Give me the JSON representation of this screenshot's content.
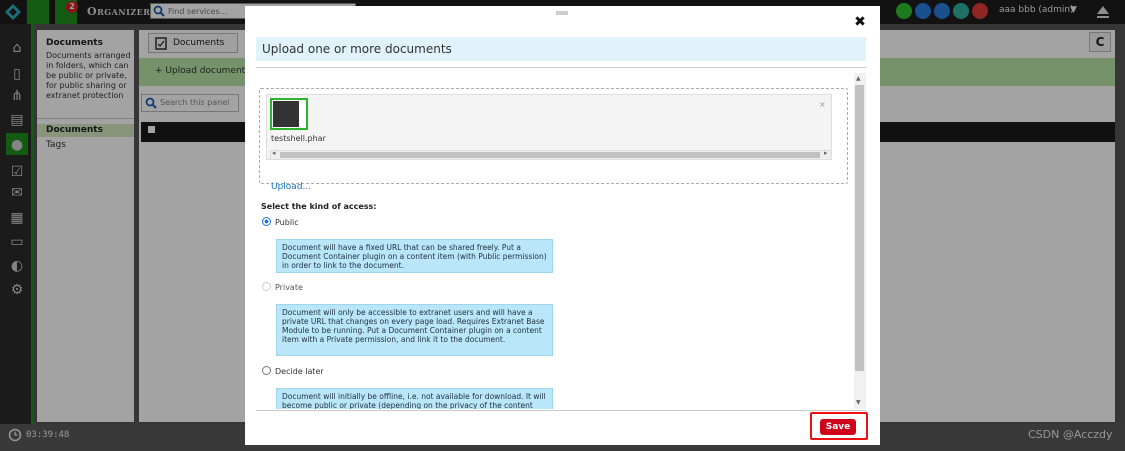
{
  "topbar": {
    "app_title": "Organizer",
    "search_placeholder": "Find services...",
    "notification_count": "2",
    "user_label": "aaa bbb (admin)",
    "user_caret": "▼",
    "status_icons": [
      "power-icon",
      "users-icon",
      "info-icon",
      "network-icon",
      "move-icon"
    ],
    "status_colors": [
      "#2ec02e",
      "#2b7de0",
      "#2b7de0",
      "#31b0a0",
      "#e03b3b"
    ]
  },
  "rail": {
    "icons": [
      "home-icon",
      "document-icon",
      "hierarchy-icon",
      "file-active-icon",
      "user-icon",
      "checkbox-icon",
      "mail-icon",
      "grid-icon",
      "folder-icon",
      "globe-icon",
      "settings-icon"
    ]
  },
  "sidebar": {
    "title": "Documents",
    "description": "Documents arranged in folders, which can be public or private, for public sharing or extranet protection",
    "items": [
      {
        "label": "Documents",
        "active": true
      },
      {
        "label": "Tags",
        "active": false
      }
    ]
  },
  "main": {
    "tab_label": "Documents",
    "add_button": "+ Upload documents",
    "panel_search_placeholder": "Search this panel",
    "refresh_icon": "C"
  },
  "modal": {
    "title": "Upload one or more documents",
    "file_name": "testshell.phar",
    "remove_symbol": "×",
    "upload_link": "Upload...",
    "access_label": "Select the kind of access:",
    "options": [
      {
        "label": "Public",
        "selected": true,
        "disabled": false,
        "info": "Document will have a fixed URL that can be shared freely. Put a Document Container plugin on a content item (with Public permission) in order to link to the document."
      },
      {
        "label": "Private",
        "selected": false,
        "disabled": true,
        "info": "Document will only be accessible to extranet users and will have a private URL that changes on every page load. Requires Extranet Base Module to be running. Put a Document Container plugin on a content item with a Private permission, and link it to the document."
      },
      {
        "label": "Decide later",
        "selected": false,
        "disabled": false,
        "info": "Document will initially be offline, i.e. not available for download. It will become public or private (depending on the privacy of the content item) when a Document Container plugin is created."
      }
    ],
    "save_label": "Save",
    "close_symbol": "✖"
  },
  "footer": {
    "clock": "03:39:48",
    "watermark": "CSDN @Acczdy"
  }
}
